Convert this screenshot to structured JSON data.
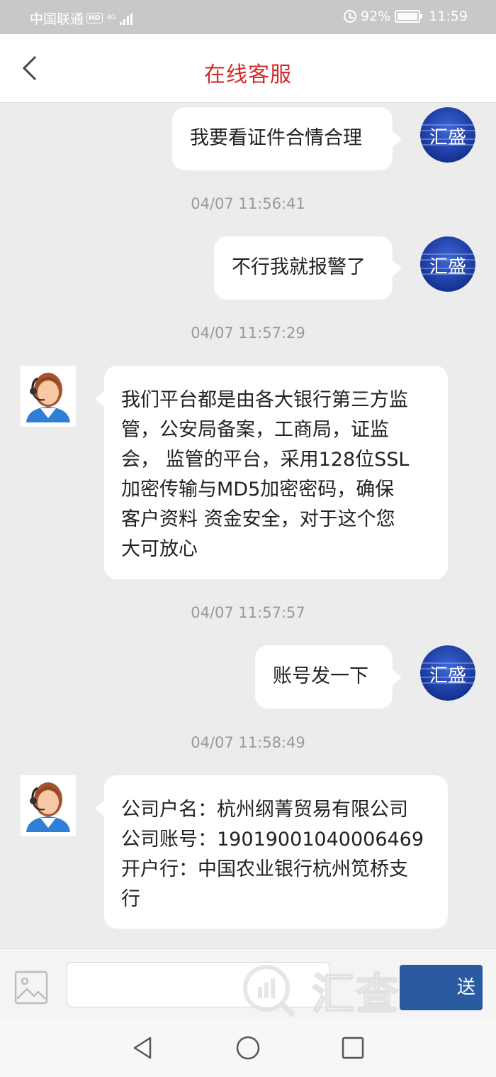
{
  "status_bar": {
    "carrier": "中国联通",
    "hd_badge": "HD",
    "network": "4G",
    "battery_percent": "92%",
    "time": "11:59"
  },
  "header": {
    "title": "在线客服"
  },
  "user": {
    "avatar_text": "汇盛"
  },
  "messages": [
    {
      "sender": "user",
      "text": "我要看证件合情合理"
    },
    {
      "timestamp": "04/07 11:56:41"
    },
    {
      "sender": "user",
      "text": "不行我就报警了"
    },
    {
      "timestamp": "04/07 11:57:29"
    },
    {
      "sender": "agent",
      "text": "我们平台都是由各大银行第三方监\n管，公安局备案，工商局，证监\n会， 监管的平台，采用128位SSL\n加密传输与MD5加密密码，确保\n客户资料 资金安全，对于这个您\n大可放心"
    },
    {
      "timestamp": "04/07 11:57:57"
    },
    {
      "sender": "user",
      "text": "账号发一下"
    },
    {
      "timestamp": "04/07 11:58:49"
    },
    {
      "sender": "agent",
      "text": "公司户名：杭州纲菁贸易有限公司\n公司账号：19019001040006469\n开户行：中国农业银行杭州笕桥支\n行"
    }
  ],
  "input": {
    "placeholder": "",
    "send_label": "送"
  },
  "watermark": {
    "text": "汇查"
  },
  "colors": {
    "title_red": "#d42a2a",
    "send_blue": "#2a5aa0",
    "avatar_blue": "#1f3fa8"
  }
}
